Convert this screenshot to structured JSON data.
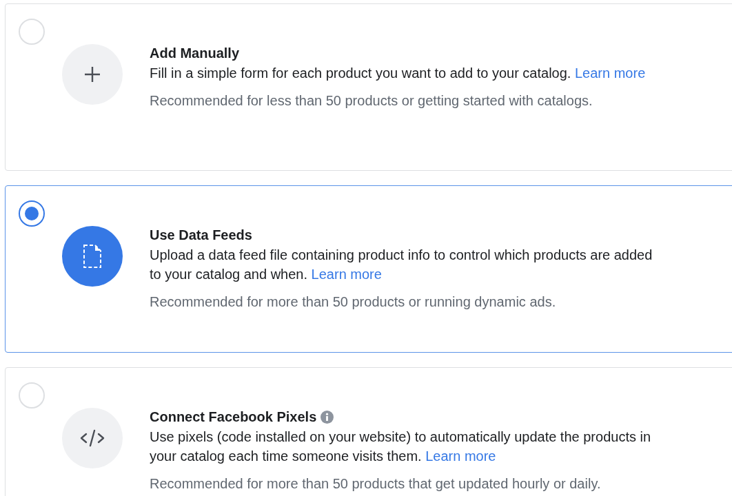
{
  "options": [
    {
      "kind": "plus",
      "title": "Add Manually",
      "info": false,
      "description": "Fill in a simple form for each product you want to add to your catalog.",
      "link": "Learn more",
      "note": "Recommended for less than 50 products or getting started with catalogs.",
      "selected": false
    },
    {
      "kind": "file",
      "title": "Use Data Feeds",
      "info": false,
      "description": "Upload a data feed file containing product info to control which products are added to your catalog and when.",
      "link": "Learn more",
      "note": "Recommended for more than 50 products or running dynamic ads.",
      "selected": true
    },
    {
      "kind": "code",
      "title": "Connect Facebook Pixels",
      "info": true,
      "description": "Use pixels (code installed on your website) to automatically update the products in your catalog each time someone visits them.",
      "link": "Learn more",
      "note": "Recommended for more than 50 products that get updated hourly or daily.",
      "selected": false
    }
  ]
}
